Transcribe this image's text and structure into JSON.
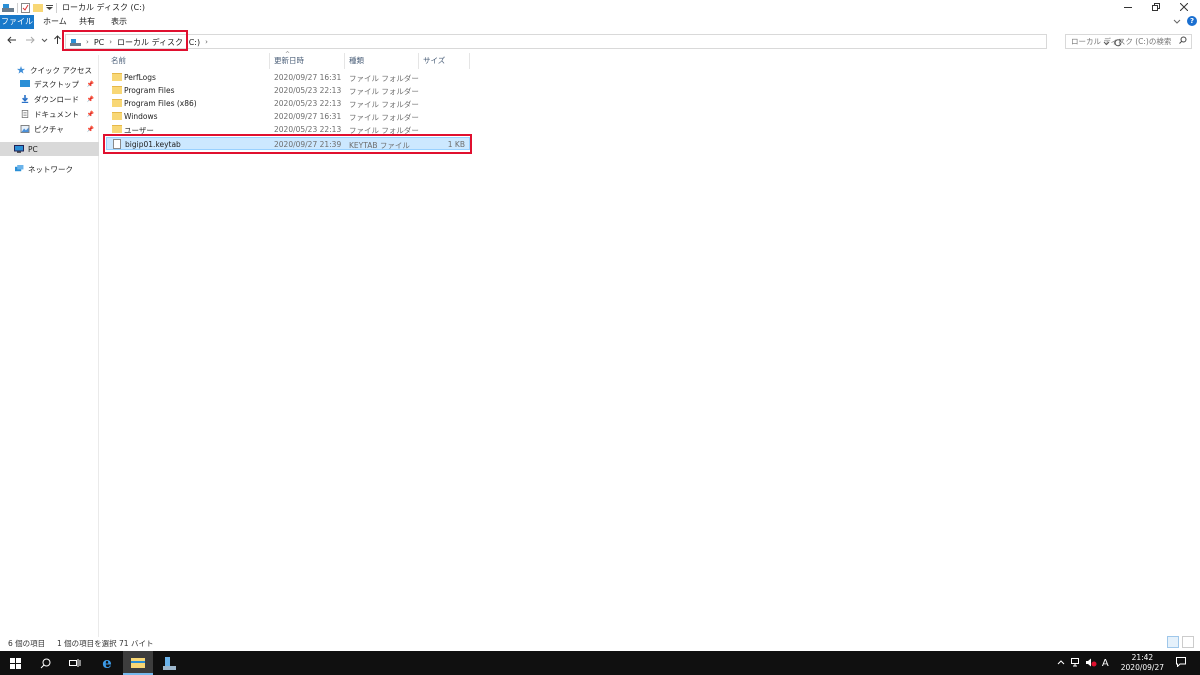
{
  "window": {
    "title": "ローカル ディスク (C:)"
  },
  "ribbon": {
    "tabs": [
      "ファイル",
      "ホーム",
      "共有",
      "表示"
    ]
  },
  "address": {
    "crumbs": [
      "PC",
      "ローカル ディスク (C:)"
    ]
  },
  "search": {
    "placeholder": "ローカル ディスク (C:)の検索"
  },
  "nav_pane": {
    "quick_access": "クイック アクセス",
    "items": [
      "デスクトップ",
      "ダウンロード",
      "ドキュメント",
      "ピクチャ"
    ],
    "pc": "PC",
    "network": "ネットワーク"
  },
  "columns": {
    "name": "名前",
    "modified": "更新日時",
    "type": "種類",
    "size": "サイズ"
  },
  "files": [
    {
      "name": "PerfLogs",
      "modified": "2020/09/27 16:31",
      "type": "ファイル フォルダー",
      "size": "",
      "kind": "folder"
    },
    {
      "name": "Program Files",
      "modified": "2020/05/23 22:13",
      "type": "ファイル フォルダー",
      "size": "",
      "kind": "folder"
    },
    {
      "name": "Program Files (x86)",
      "modified": "2020/05/23 22:13",
      "type": "ファイル フォルダー",
      "size": "",
      "kind": "folder"
    },
    {
      "name": "Windows",
      "modified": "2020/09/27 16:31",
      "type": "ファイル フォルダー",
      "size": "",
      "kind": "folder"
    },
    {
      "name": "ユーザー",
      "modified": "2020/05/23 22:13",
      "type": "ファイル フォルダー",
      "size": "",
      "kind": "folder"
    },
    {
      "name": "bigip01.keytab",
      "modified": "2020/09/27 21:39",
      "type": "KEYTAB ファイル",
      "size": "1 KB",
      "kind": "file",
      "selected": true
    }
  ],
  "status": {
    "item_count": "6 個の項目",
    "selection": "1 個の項目を選択  71 バイト"
  },
  "taskbar": {
    "time": "21:42",
    "date": "2020/09/27",
    "ime": "A"
  },
  "colors": {
    "accent": "#1979ca",
    "selection": "#cce8ff",
    "highlight": "#e0102f"
  }
}
